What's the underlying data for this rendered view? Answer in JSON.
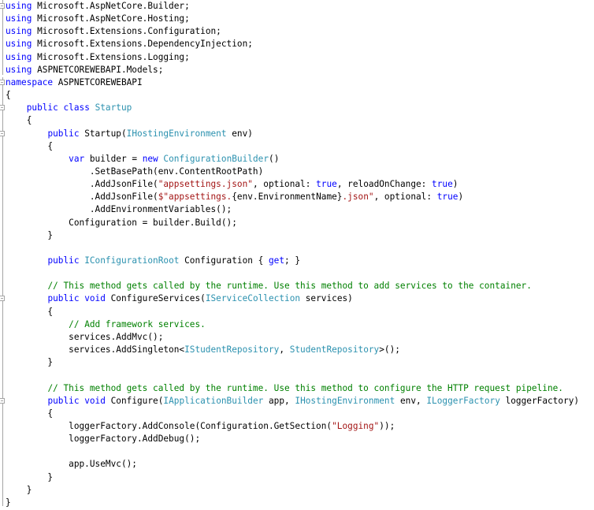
{
  "editor": {
    "language": "C#",
    "lines": [
      [
        {
          "t": "using",
          "c": "kw"
        },
        {
          "t": " Microsoft.AspNetCore.Builder;"
        }
      ],
      [
        {
          "t": "using",
          "c": "kw"
        },
        {
          "t": " Microsoft.AspNetCore.Hosting;"
        }
      ],
      [
        {
          "t": "using",
          "c": "kw"
        },
        {
          "t": " Microsoft.Extensions.Configuration;"
        }
      ],
      [
        {
          "t": "using",
          "c": "kw"
        },
        {
          "t": " Microsoft.Extensions.DependencyInjection;"
        }
      ],
      [
        {
          "t": "using",
          "c": "kw"
        },
        {
          "t": " Microsoft.Extensions.Logging;"
        }
      ],
      [
        {
          "t": "using",
          "c": "kw"
        },
        {
          "t": " ASPNETCOREWEBAPI.Models;"
        }
      ],
      [
        {
          "t": "namespace",
          "c": "kw"
        },
        {
          "t": " ASPNETCOREWEBAPI"
        }
      ],
      [
        {
          "t": "{"
        }
      ],
      [
        {
          "t": "    "
        },
        {
          "t": "public",
          "c": "kw"
        },
        {
          "t": " "
        },
        {
          "t": "class",
          "c": "kw"
        },
        {
          "t": " "
        },
        {
          "t": "Startup",
          "c": "ty"
        }
      ],
      [
        {
          "t": "    {"
        }
      ],
      [
        {
          "t": "        "
        },
        {
          "t": "public",
          "c": "kw"
        },
        {
          "t": " Startup("
        },
        {
          "t": "IHostingEnvironment",
          "c": "ty"
        },
        {
          "t": " env)"
        }
      ],
      [
        {
          "t": "        {"
        }
      ],
      [
        {
          "t": "            "
        },
        {
          "t": "var",
          "c": "kw"
        },
        {
          "t": " builder = "
        },
        {
          "t": "new",
          "c": "kw"
        },
        {
          "t": " "
        },
        {
          "t": "ConfigurationBuilder",
          "c": "ty"
        },
        {
          "t": "()"
        }
      ],
      [
        {
          "t": "                .SetBasePath(env.ContentRootPath)"
        }
      ],
      [
        {
          "t": "                .AddJsonFile("
        },
        {
          "t": "\"appsettings.json\"",
          "c": "str"
        },
        {
          "t": ", optional: "
        },
        {
          "t": "true",
          "c": "kw"
        },
        {
          "t": ", reloadOnChange: "
        },
        {
          "t": "true",
          "c": "kw"
        },
        {
          "t": ")"
        }
      ],
      [
        {
          "t": "                .AddJsonFile("
        },
        {
          "t": "$\"appsettings.",
          "c": "str"
        },
        {
          "t": "{env.EnvironmentName}"
        },
        {
          "t": ".json\"",
          "c": "str"
        },
        {
          "t": ", optional: "
        },
        {
          "t": "true",
          "c": "kw"
        },
        {
          "t": ")"
        }
      ],
      [
        {
          "t": "                .AddEnvironmentVariables();"
        }
      ],
      [
        {
          "t": "            Configuration = builder.Build();"
        }
      ],
      [
        {
          "t": "        }"
        }
      ],
      [
        {
          "t": ""
        }
      ],
      [
        {
          "t": "        "
        },
        {
          "t": "public",
          "c": "kw"
        },
        {
          "t": " "
        },
        {
          "t": "IConfigurationRoot",
          "c": "ty"
        },
        {
          "t": " Configuration { "
        },
        {
          "t": "get",
          "c": "kw"
        },
        {
          "t": "; }"
        }
      ],
      [
        {
          "t": ""
        }
      ],
      [
        {
          "t": "        "
        },
        {
          "t": "// This method gets called by the runtime. Use this method to add services to the container.",
          "c": "cm"
        }
      ],
      [
        {
          "t": "        "
        },
        {
          "t": "public",
          "c": "kw"
        },
        {
          "t": " "
        },
        {
          "t": "void",
          "c": "kw"
        },
        {
          "t": " ConfigureServices("
        },
        {
          "t": "IServiceCollection",
          "c": "ty"
        },
        {
          "t": " services)"
        }
      ],
      [
        {
          "t": "        {"
        }
      ],
      [
        {
          "t": "            "
        },
        {
          "t": "// Add framework services.",
          "c": "cm"
        }
      ],
      [
        {
          "t": "            services.AddMvc();"
        }
      ],
      [
        {
          "t": "            services.AddSingleton<"
        },
        {
          "t": "IStudentRepository",
          "c": "ty"
        },
        {
          "t": ", "
        },
        {
          "t": "StudentRepository",
          "c": "ty"
        },
        {
          "t": ">();"
        }
      ],
      [
        {
          "t": "        }"
        }
      ],
      [
        {
          "t": ""
        }
      ],
      [
        {
          "t": "        "
        },
        {
          "t": "// This method gets called by the runtime. Use this method to configure the HTTP request pipeline.",
          "c": "cm"
        }
      ],
      [
        {
          "t": "        "
        },
        {
          "t": "public",
          "c": "kw"
        },
        {
          "t": " "
        },
        {
          "t": "void",
          "c": "kw"
        },
        {
          "t": " Configure("
        },
        {
          "t": "IApplicationBuilder",
          "c": "ty"
        },
        {
          "t": " app, "
        },
        {
          "t": "IHostingEnvironment",
          "c": "ty"
        },
        {
          "t": " env, "
        },
        {
          "t": "ILoggerFactory",
          "c": "ty"
        },
        {
          "t": " loggerFactory)"
        }
      ],
      [
        {
          "t": "        {"
        }
      ],
      [
        {
          "t": "            loggerFactory.AddConsole(Configuration.GetSection("
        },
        {
          "t": "\"Logging\"",
          "c": "str"
        },
        {
          "t": "));"
        }
      ],
      [
        {
          "t": "            loggerFactory.AddDebug();"
        }
      ],
      [
        {
          "t": ""
        }
      ],
      [
        {
          "t": "            app.UseMvc();"
        }
      ],
      [
        {
          "t": "        }"
        }
      ],
      [
        {
          "t": "    }"
        }
      ],
      [
        {
          "t": "}"
        }
      ]
    ]
  },
  "colors": {
    "keyword": "#0000ff",
    "type": "#2b91af",
    "string": "#a31515",
    "comment": "#008000",
    "plain": "#000000"
  }
}
